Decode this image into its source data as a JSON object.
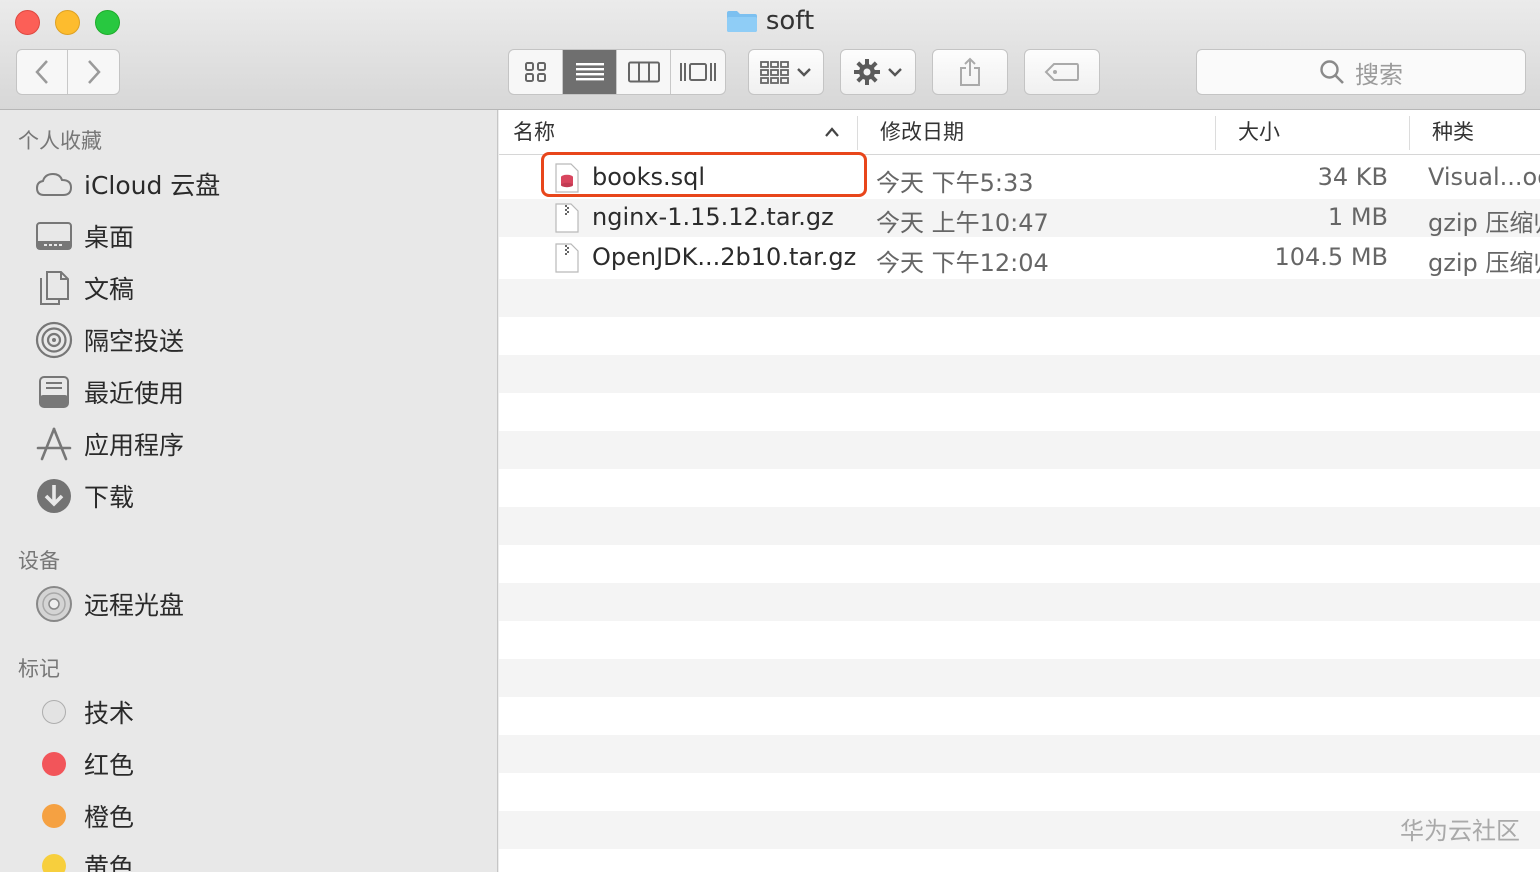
{
  "window": {
    "title": "soft",
    "folder_icon": "folder-icon"
  },
  "toolbar": {
    "search_placeholder": "搜索"
  },
  "sidebar": {
    "favorites_header": "个人收藏",
    "favorites": [
      {
        "label": "iCloud 云盘",
        "icon": "cloud-icon"
      },
      {
        "label": "桌面",
        "icon": "desktop-icon"
      },
      {
        "label": "文稿",
        "icon": "documents-icon"
      },
      {
        "label": "隔空投送",
        "icon": "airdrop-icon"
      },
      {
        "label": "最近使用",
        "icon": "recents-icon"
      },
      {
        "label": "应用程序",
        "icon": "applications-icon"
      },
      {
        "label": "下载",
        "icon": "downloads-icon"
      }
    ],
    "devices_header": "设备",
    "devices": [
      {
        "label": "远程光盘",
        "icon": "disc-icon"
      }
    ],
    "tags_header": "标记",
    "tags": [
      {
        "label": "技术",
        "color": "#e3e3e3"
      },
      {
        "label": "红色",
        "color": "#f2555a"
      },
      {
        "label": "橙色",
        "color": "#f5a142"
      },
      {
        "label": "黄色",
        "color": "#f7cf3d"
      }
    ]
  },
  "columns": {
    "name": "名称",
    "date": "修改日期",
    "size": "大小",
    "kind": "种类"
  },
  "files": [
    {
      "name": "books.sql",
      "date": "今天 下午5:33",
      "size": "34 KB",
      "kind": "Visual...od"
    },
    {
      "name": "nginx-1.15.12.tar.gz",
      "date": "今天 上午10:47",
      "size": "1 MB",
      "kind": "gzip 压缩归"
    },
    {
      "name": "OpenJDK...2b10.tar.gz",
      "date": "今天 下午12:04",
      "size": "104.5 MB",
      "kind": "gzip 压缩归"
    }
  ],
  "watermark": "华为云社区",
  "colors": {
    "highlight": "#e8461b",
    "accent": "#6f6f6f"
  }
}
